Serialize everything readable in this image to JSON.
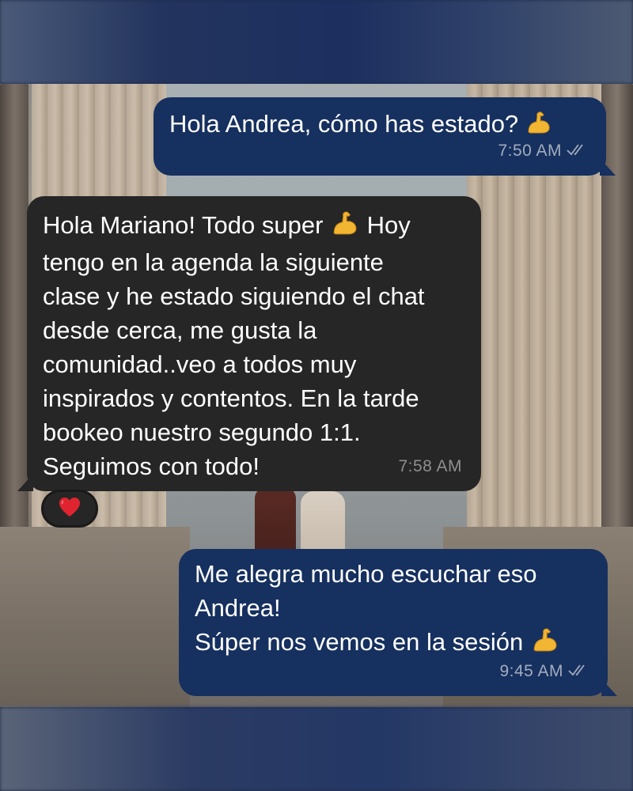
{
  "chat": {
    "messages": [
      {
        "direction": "outgoing",
        "text": "Hola Andrea, cómo has estado?",
        "emoji": "flexed-biceps",
        "time": "7:50 AM",
        "status": "read"
      },
      {
        "direction": "incoming",
        "lines": [
          "Hola Mariano! Todo super ",
          " Hoy",
          "tengo en la agenda la siguiente",
          "clase y he estado siguiendo el chat",
          "desde cerca, me gusta la",
          "comunidad..veo a todos muy",
          "inspirados y contentos. En la tarde",
          "bookeo nuestro segundo 1:1.",
          "Seguimos con todo!"
        ],
        "time": "7:58 AM",
        "reaction": "red-heart"
      },
      {
        "direction": "outgoing",
        "lines": [
          "Me alegra mucho escuchar eso",
          "Andrea!",
          "Súper nos vemos en la sesión "
        ],
        "emoji": "flexed-biceps",
        "time": "9:45 AM",
        "status": "read"
      }
    ]
  },
  "colors": {
    "outgoing_bubble": "#16305f",
    "incoming_bubble": "#262626",
    "timestamp_out": "#a2acbd",
    "timestamp_in": "#8f8f8f",
    "read_ticks": "#a2acbd",
    "emoji_biceps": "#f2b632",
    "heart": "#e0242f"
  },
  "icons": {
    "read_status": "double-check-icon",
    "biceps": "flexed-biceps-emoji",
    "reaction": "red-heart-emoji"
  }
}
